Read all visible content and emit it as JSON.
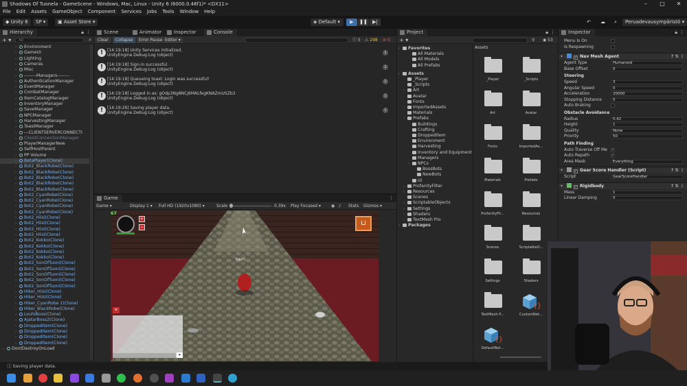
{
  "window": {
    "title": "Shadows Of Tuonela - GameScene - Windows, Mac, Linux - Unity 6 (6000.0.46f1)* <DX11>"
  },
  "menu": [
    "File",
    "Edit",
    "Assets",
    "GameObject",
    "Component",
    "Services",
    "Jobs",
    "Tools",
    "Window",
    "Help"
  ],
  "toolbar": {
    "product": "Unity 6",
    "account": "SP",
    "asset_store": "Asset Store",
    "layout": "Default",
    "user": "Peruadevausympäristö"
  },
  "hierarchy": {
    "tab": "Hierarchy",
    "search_placeholder": "All",
    "rows": [
      {
        "label": "Environment",
        "type": "go",
        "indent": 1
      },
      {
        "label": "GameUI",
        "type": "go",
        "indent": 1
      },
      {
        "label": "Lighting",
        "type": "go",
        "indent": 1
      },
      {
        "label": "Cameras",
        "type": "go",
        "indent": 1
      },
      {
        "label": "Misc",
        "type": "go",
        "indent": 1
      },
      {
        "label": "--------Managers--------",
        "type": "go",
        "indent": 1
      },
      {
        "label": "AuthenticationManager",
        "type": "go",
        "indent": 1
      },
      {
        "label": "EventManager",
        "type": "go",
        "indent": 1
      },
      {
        "label": "CombatManager",
        "type": "go",
        "indent": 1
      },
      {
        "label": "ItemCatalogManager",
        "type": "go",
        "indent": 1
      },
      {
        "label": "InventoryManager",
        "type": "go",
        "indent": 1
      },
      {
        "label": "SaveManager",
        "type": "go",
        "indent": 1
      },
      {
        "label": "NPCManager",
        "type": "go",
        "indent": 1
      },
      {
        "label": "HarvestingManager",
        "type": "go",
        "indent": 1
      },
      {
        "label": "ToastManager",
        "type": "go",
        "indent": 1
      },
      {
        "label": "---CLIENTSERVERCONNECTI",
        "type": "go",
        "indent": 1
      },
      {
        "label": "ClientConnectionManager",
        "type": "faded",
        "indent": 1
      },
      {
        "label": "PlayerManagerNew",
        "type": "go",
        "indent": 1
      },
      {
        "label": "SelfHostParent",
        "type": "go",
        "indent": 1
      },
      {
        "label": "PP Volume",
        "type": "go",
        "indent": 1
      },
      {
        "label": "BetaPlayer(Clone)",
        "type": "prefab",
        "indent": 1,
        "selected": true
      },
      {
        "label": "Bot2_BlackRobe(Clone)",
        "type": "prefab",
        "indent": 1
      },
      {
        "label": "Bot2_BlackRobe(Clone)",
        "type": "prefab",
        "indent": 1
      },
      {
        "label": "Bot2_BlackRobe(Clone)",
        "type": "prefab",
        "indent": 1
      },
      {
        "label": "Bot2_BlackRobe(Clone)",
        "type": "prefab",
        "indent": 1
      },
      {
        "label": "Bot2_BlackRobe(Clone)",
        "type": "prefab",
        "indent": 1
      },
      {
        "label": "Bot2_CyanRobe(Clone)",
        "type": "prefab",
        "indent": 1
      },
      {
        "label": "Bot2_CyanRobe(Clone)",
        "type": "prefab",
        "indent": 1
      },
      {
        "label": "Bot2_CyanRobe(Clone)",
        "type": "prefab",
        "indent": 1
      },
      {
        "label": "Bot2_CyanRobe(Clone)",
        "type": "prefab",
        "indent": 1
      },
      {
        "label": "Bot2_Hiisi(Clone)",
        "type": "prefab",
        "indent": 1
      },
      {
        "label": "Bot2_Hiisi(Clone)",
        "type": "prefab",
        "indent": 1
      },
      {
        "label": "Bot2_Hiisi(Clone)",
        "type": "prefab",
        "indent": 1
      },
      {
        "label": "Bot2_Hiisi(Clone)",
        "type": "prefab",
        "indent": 1
      },
      {
        "label": "Bot2_Kokko(Clone)",
        "type": "prefab",
        "indent": 1
      },
      {
        "label": "Bot2_Kokko(Clone)",
        "type": "prefab",
        "indent": 1
      },
      {
        "label": "Bot2_Kokko(Clone)",
        "type": "prefab",
        "indent": 1
      },
      {
        "label": "Bot2_Kokko(Clone)",
        "type": "prefab",
        "indent": 1
      },
      {
        "label": "Bot2_SonOfTuoni(Clone)",
        "type": "prefab",
        "indent": 1
      },
      {
        "label": "Bot2_SonOfTuoni(Clone)",
        "type": "prefab",
        "indent": 1
      },
      {
        "label": "Bot2_SonOfTuoni(Clone)",
        "type": "prefab",
        "indent": 1
      },
      {
        "label": "Bot2_SonOfTuoni(Clone)",
        "type": "prefab",
        "indent": 1
      },
      {
        "label": "Bot2_SonOfTuoni(Clone)",
        "type": "prefab",
        "indent": 1
      },
      {
        "label": "Hiker_Hiisi(Clone)",
        "type": "prefab",
        "indent": 1
      },
      {
        "label": "Hiker_Hiisi(Clone)",
        "type": "prefab",
        "indent": 1
      },
      {
        "label": "Hiker_CyanRobe 1(Clone)",
        "type": "prefab",
        "indent": 1
      },
      {
        "label": "Hiker_BlackRobe(Clone)",
        "type": "prefab",
        "indent": 1
      },
      {
        "label": "LouhiBoss(Clone)",
        "type": "prefab",
        "indent": 1
      },
      {
        "label": "AjatarBoss2(Clone)",
        "type": "prefab",
        "indent": 1
      },
      {
        "label": "DroppedItem(Clone)",
        "type": "prefab",
        "indent": 1
      },
      {
        "label": "DroppedItem(Clone)",
        "type": "prefab",
        "indent": 1
      },
      {
        "label": "DroppedItem(Clone)",
        "type": "prefab",
        "indent": 1
      },
      {
        "label": "DroppedItem(Clone)",
        "type": "prefab",
        "indent": 1
      },
      {
        "label": "DontDestroyOnLoad",
        "type": "go",
        "indent": 0
      }
    ]
  },
  "center_tabs": [
    "Scene",
    "Animator",
    "Inspector",
    "Console"
  ],
  "console": {
    "buttons": [
      "Clear",
      "Collapse",
      "Error Pause",
      "Editor"
    ],
    "badge_info": "5",
    "badge_warn": "298",
    "badge_error": "0",
    "logs": [
      {
        "line1": "[14:19:18] Unity Services initialized.",
        "line2": "UnityEngine.Debug:Log (object)",
        "count": "1"
      },
      {
        "line1": "[14:19:18] Sign-in successful.",
        "line2": "UnityEngine.Debug:Log (object)",
        "count": "1"
      },
      {
        "line1": "[14:19:18] Queueing toast: Login was successful!",
        "line2": "UnityEngine.Debug:Log (object)",
        "count": "1"
      },
      {
        "line1": "[14:19:18] Logged in as: gOdp3Ng8NCj6MALfegKNAZmUSZb3",
        "line2": "UnityEngine.Debug:Log (object)",
        "count": "1"
      },
      {
        "line1": "[14:19:26] Saving player data.",
        "line2": "UnityEngine.Debug:Log (object)",
        "count": "1"
      }
    ]
  },
  "game": {
    "tab": "Game",
    "display_mode": "Game",
    "display": "Display 1",
    "resolution": "Full HD (1920x1080)",
    "scale_label": "Scale",
    "scale_value": "0.39x",
    "play_mode": "Play Focused",
    "stats": "Stats",
    "gizmos": "Gizmos",
    "fps": "67",
    "player_name": "harri"
  },
  "project": {
    "tab": "Project",
    "favorites_label": "Favorites",
    "favorites": [
      "All Materials",
      "All Models",
      "All Prefabs"
    ],
    "assets_label": "Assets",
    "tree": [
      {
        "label": "_Player",
        "indent": 1
      },
      {
        "label": "_Scripts",
        "indent": 1
      },
      {
        "label": "Art",
        "indent": 1,
        "arrow": true
      },
      {
        "label": "Avatar",
        "indent": 1
      },
      {
        "label": "Fonts",
        "indent": 1
      },
      {
        "label": "ImportedAssets",
        "indent": 1,
        "arrow": true
      },
      {
        "label": "Materials",
        "indent": 1
      },
      {
        "label": "Prefabs",
        "indent": 1,
        "arrow": true
      },
      {
        "label": "Buildings",
        "indent": 2
      },
      {
        "label": "Crafting",
        "indent": 2
      },
      {
        "label": "DroppedItem",
        "indent": 2
      },
      {
        "label": "Environment",
        "indent": 2
      },
      {
        "label": "Harvesting",
        "indent": 2
      },
      {
        "label": "Inventory and Equipment",
        "indent": 2
      },
      {
        "label": "Managers",
        "indent": 2
      },
      {
        "label": "NPCs",
        "indent": 2,
        "arrow": true
      },
      {
        "label": "BossBots",
        "indent": 3
      },
      {
        "label": "NewBots",
        "indent": 3
      },
      {
        "label": "UI",
        "indent": 2
      },
      {
        "label": "ProfanityFilter",
        "indent": 1,
        "arrow": true
      },
      {
        "label": "Resources",
        "indent": 1,
        "arrow": true
      },
      {
        "label": "Scenes",
        "indent": 1
      },
      {
        "label": "ScriptableObjects",
        "indent": 1,
        "arrow": true
      },
      {
        "label": "Settings",
        "indent": 1,
        "arrow": true
      },
      {
        "label": "Shaders",
        "indent": 1,
        "arrow": true
      },
      {
        "label": "TextMesh Pro",
        "indent": 1,
        "arrow": true
      }
    ],
    "packages_label": "Packages",
    "breadcrumb": "Assets",
    "count": "53",
    "grid": [
      {
        "label": "_Player",
        "kind": "folder"
      },
      {
        "label": "_Scripts",
        "kind": "folder"
      },
      {
        "label": "Art",
        "kind": "folder"
      },
      {
        "label": "Avatar",
        "kind": "folder"
      },
      {
        "label": "Fonts",
        "kind": "folder"
      },
      {
        "label": "ImportedAs...",
        "kind": "folder"
      },
      {
        "label": "Materials",
        "kind": "folder"
      },
      {
        "label": "Prefabs",
        "kind": "folder"
      },
      {
        "label": "ProfanityFil...",
        "kind": "folder"
      },
      {
        "label": "Resources",
        "kind": "folder"
      },
      {
        "label": "Scenes",
        "kind": "folder"
      },
      {
        "label": "ScriptableO...",
        "kind": "folder"
      },
      {
        "label": "Settings",
        "kind": "folder"
      },
      {
        "label": "Shaders",
        "kind": "folder"
      },
      {
        "label": "TextMesh P...",
        "kind": "folder"
      },
      {
        "label": "CustomNet...",
        "kind": "script"
      },
      {
        "label": "DefaultNet...",
        "kind": "script"
      }
    ]
  },
  "inspector": {
    "tab": "Inspector",
    "top_rows": [
      {
        "label": "Menu Is On",
        "type": "check",
        "value": ""
      },
      {
        "label": "Is Respawning",
        "type": "check",
        "value": ""
      }
    ],
    "nav_mesh_agent": {
      "title": "Nav Mesh Agent",
      "rows": [
        {
          "label": "Agent Type",
          "value": "Humanoid"
        },
        {
          "label": "Base Offset",
          "value": "0"
        }
      ],
      "steering_label": "Steering",
      "steering": [
        {
          "label": "Speed",
          "value": "3"
        },
        {
          "label": "Angular Speed",
          "value": "0"
        },
        {
          "label": "Acceleration",
          "value": "20000"
        },
        {
          "label": "Stopping Distance",
          "value": "0"
        }
      ],
      "auto_braking": "Auto Braking",
      "avoidance_label": "Obstacle Avoidance",
      "avoidance": [
        {
          "label": "Radius",
          "value": "0.42"
        },
        {
          "label": "Height",
          "value": "1"
        },
        {
          "label": "Quality",
          "value": "None"
        },
        {
          "label": "Priority",
          "value": "50"
        }
      ],
      "pathfinding_label": "Path Finding",
      "auto_traverse": "Auto Traverse Off Me",
      "auto_traverse_check": "✓",
      "auto_repath": "Auto Repath",
      "auto_repath_check": "✓",
      "area_mask": "Area Mask",
      "area_mask_value": "Everything"
    },
    "gear_handler": {
      "title": "Gear Score Handler (Script)",
      "script_label": "Script",
      "script_value": "GearScoreHandler"
    },
    "rigidbody": {
      "title": "Rigidbody",
      "rows": [
        {
          "label": "Mass",
          "value": "1"
        },
        {
          "label": "Linear Damping",
          "value": "0"
        }
      ]
    }
  },
  "status": {
    "text": "Saving player data."
  },
  "colors": {
    "accent": "#3d6ea8",
    "prefab_text": "#7fb0e8",
    "panel_bg": "#282828"
  }
}
